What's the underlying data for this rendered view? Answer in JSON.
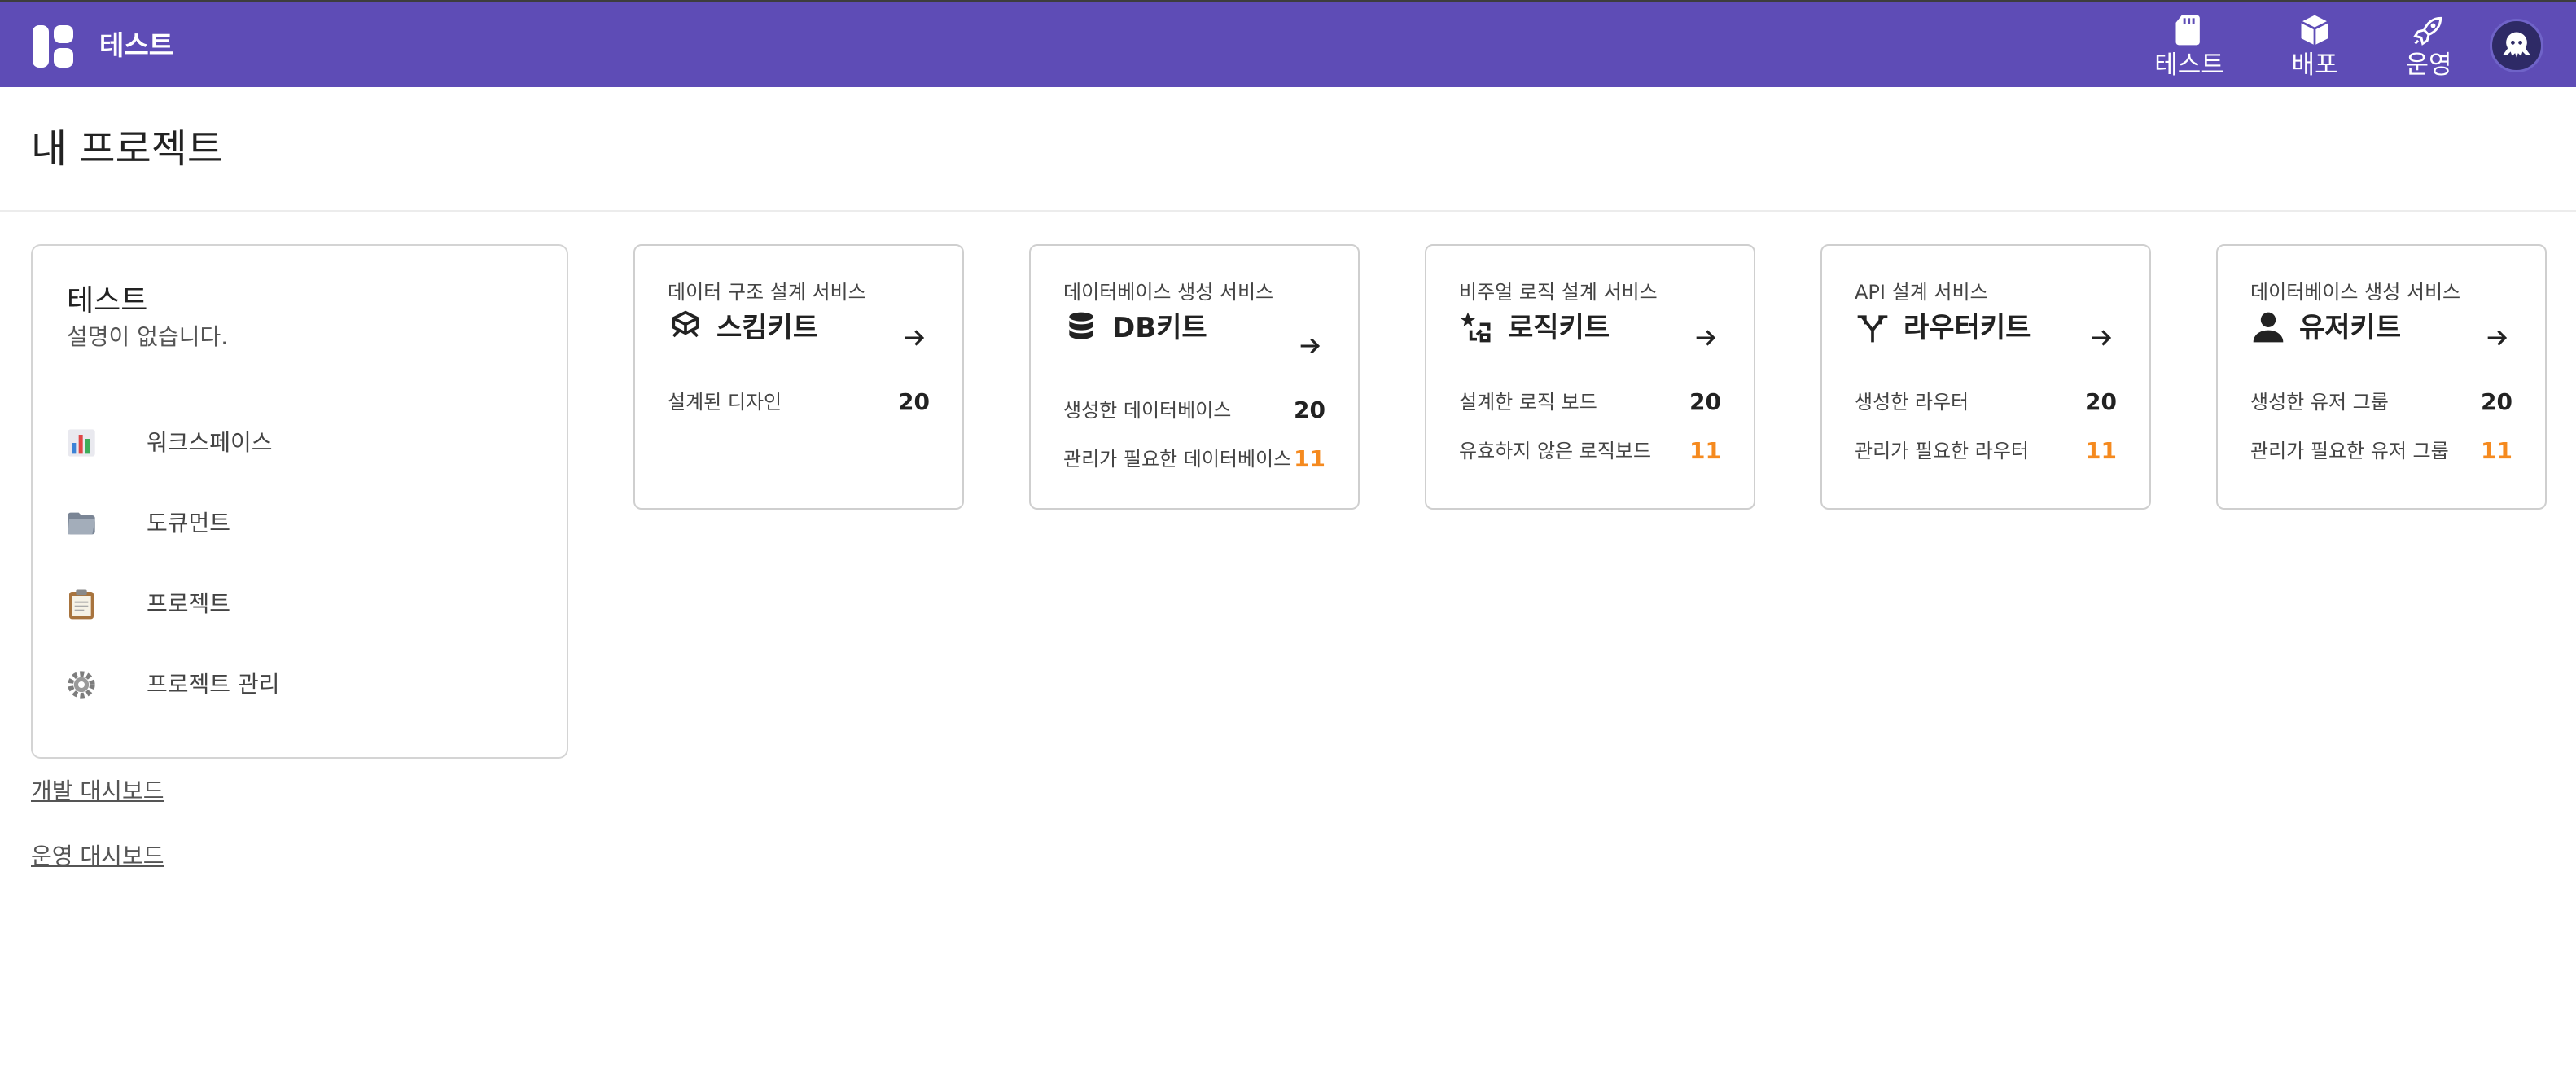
{
  "header": {
    "brand": "테스트",
    "nav": [
      {
        "label": "테스트",
        "icon": "sd-card-icon"
      },
      {
        "label": "배포",
        "icon": "cube-icon"
      },
      {
        "label": "운영",
        "icon": "rocket-icon"
      }
    ],
    "bg_color": "#5e4cb6"
  },
  "page": {
    "title": "내 프로젝트"
  },
  "project": {
    "name": "테스트",
    "description": "설명이 없습니다.",
    "menu": [
      {
        "label": "워크스페이스",
        "icon": "bar-chart-icon"
      },
      {
        "label": "도큐먼트",
        "icon": "folder-icon"
      },
      {
        "label": "프로젝트",
        "icon": "clipboard-icon"
      },
      {
        "label": "프로젝트 관리",
        "icon": "gear-icon"
      }
    ]
  },
  "links": {
    "dev_dashboard": "개발 대시보드",
    "ops_dashboard": "운영 대시보드"
  },
  "services": [
    {
      "subtitle": "데이터 구조 설계 서비스",
      "name": "스킴키트",
      "icon": "box-outline-icon",
      "stats": [
        {
          "label": "설계된 디자인",
          "value": "20"
        }
      ]
    },
    {
      "subtitle": "데이터베이스 생성 서비스",
      "name": "DB키트",
      "icon": "database-icon",
      "stats": [
        {
          "label": "생성한 데이터베이스",
          "value": "20"
        },
        {
          "label": "관리가 필요한 데이터베이스",
          "value": "11"
        }
      ]
    },
    {
      "subtitle": "비주얼 로직 설계 서비스",
      "name": "로직키트",
      "icon": "logic-flow-icon",
      "stats": [
        {
          "label": "설계한 로직 보드",
          "value": "20"
        },
        {
          "label": "유효하지 않은 로직보드",
          "value": "11"
        }
      ]
    },
    {
      "subtitle": "API 설계 서비스",
      "name": "라우터키트",
      "icon": "fork-arrows-icon",
      "stats": [
        {
          "label": "생성한 라우터",
          "value": "20"
        },
        {
          "label": "관리가 필요한 라우터",
          "value": "11"
        }
      ]
    },
    {
      "subtitle": "데이터베이스 생성 서비스",
      "name": "유저키트",
      "icon": "person-icon",
      "stats": [
        {
          "label": "생성한 유저 그룹",
          "value": "20"
        },
        {
          "label": "관리가 필요한 유저 그룹",
          "value": "11"
        }
      ]
    }
  ],
  "colors": {
    "warning": "#f58a1f",
    "accent": "#5e4cb6"
  }
}
